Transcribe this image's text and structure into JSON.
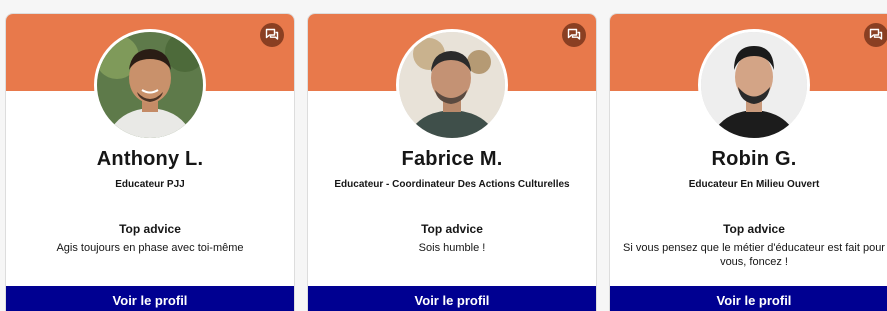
{
  "colors": {
    "banner": "#e8794b",
    "chat_button": "#8a3f22",
    "profile_button": "#000091",
    "text": "#161616"
  },
  "chat_icon": "chat-bubbles-icon",
  "advice_label": "Top advice",
  "profile_button_label": "Voir le profil",
  "cards": [
    {
      "name": "Anthony L.",
      "role": "Educateur PJJ",
      "advice": "Agis toujours en phase avec toi-même"
    },
    {
      "name": "Fabrice M.",
      "role": "Educateur - Coordinateur Des Actions Culturelles",
      "advice": "Sois humble !"
    },
    {
      "name": "Robin G.",
      "role": "Educateur En Milieu Ouvert",
      "advice": "Si vous pensez que le métier d'éducateur est fait pour vous, foncez !"
    }
  ]
}
